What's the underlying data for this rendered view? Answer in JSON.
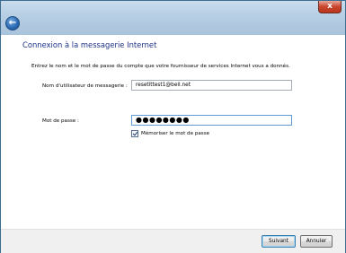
{
  "window": {
    "close_label": "x",
    "back_icon": "back-arrow-icon"
  },
  "page": {
    "title": "Connexion à la messagerie Internet",
    "instructions": "Entrez le nom et le mot de passe du compte que votre fournisseur de services Internet vous a donnés."
  },
  "form": {
    "username_label": "Nom d'utilisateur de messagerie :",
    "username_value": "resetittest1@bell.net",
    "password_label": "Mot de passe :",
    "password_value": "●●●●●●●●",
    "remember_label": "Mémoriser le mot de passe",
    "remember_checked": true
  },
  "buttons": {
    "next": "Suivant",
    "cancel": "Annuler"
  },
  "colors": {
    "title": "#1e3287",
    "titlebar": "#b8cfe4",
    "close": "#c9452d"
  }
}
